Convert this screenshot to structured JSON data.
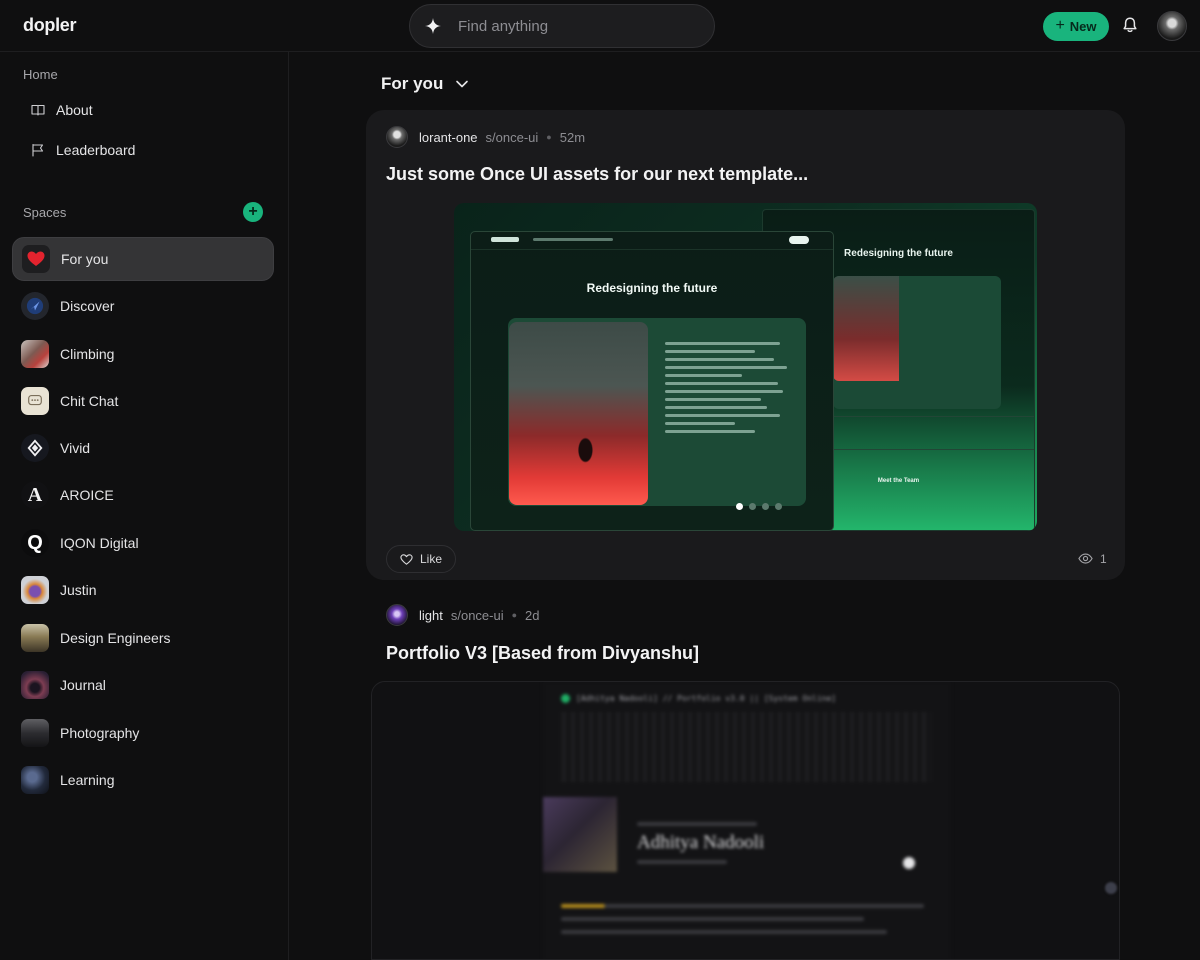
{
  "app": {
    "name": "dopler"
  },
  "search": {
    "placeholder": "Find anything",
    "icon": "sparkle-icon"
  },
  "header": {
    "new_label": "New",
    "bell_icon": "bell-icon",
    "avatar": "avatar"
  },
  "sidebar": {
    "home_label": "Home",
    "links": [
      {
        "label": "About",
        "icon": "book-icon"
      },
      {
        "label": "Leaderboard",
        "icon": "flag-icon"
      }
    ],
    "spaces_label": "Spaces",
    "add_space_icon": "plus-icon",
    "spaces": [
      {
        "label": "For you",
        "icon": "heart-icon",
        "active": true
      },
      {
        "label": "Discover",
        "icon": "discover-icon"
      },
      {
        "label": "Climbing",
        "icon": "climbing-icon"
      },
      {
        "label": "Chit Chat",
        "icon": "chat-icon"
      },
      {
        "label": "Vivid",
        "icon": "diamond-icon"
      },
      {
        "label": "AROICE",
        "icon": "letter-a-icon"
      },
      {
        "label": "IQON Digital",
        "icon": "letter-q-icon"
      },
      {
        "label": "Justin",
        "icon": "avatar-icon"
      },
      {
        "label": "Design Engineers",
        "icon": "avatar-icon"
      },
      {
        "label": "Journal",
        "icon": "avatar-icon"
      },
      {
        "label": "Photography",
        "icon": "avatar-icon"
      },
      {
        "label": "Learning",
        "icon": "avatar-icon"
      }
    ]
  },
  "feed": {
    "title": "For you",
    "posts": [
      {
        "author": "lorant-one",
        "space": "s/once-ui",
        "time": "52m",
        "title": "Just some Once UI assets for our next template...",
        "image": {
          "back_title": "Redesigning the future",
          "front_title": "Redesigning the future",
          "team_label": "Meet the Team"
        },
        "like_label": "Like",
        "views": "1"
      },
      {
        "author": "light",
        "space": "s/once-ui",
        "time": "2d",
        "title": "Portfolio V3 [Based from Divyanshu]",
        "image": {
          "header_text": "[Adhitya Nadooli] // Portfolio v3.0 || [System Online]",
          "name": "Adhitya Nadooli"
        }
      }
    ]
  },
  "colors": {
    "accent": "#19b47d",
    "background": "#0f0f10",
    "card": "#1a1a1c",
    "active_item": "#343436"
  }
}
